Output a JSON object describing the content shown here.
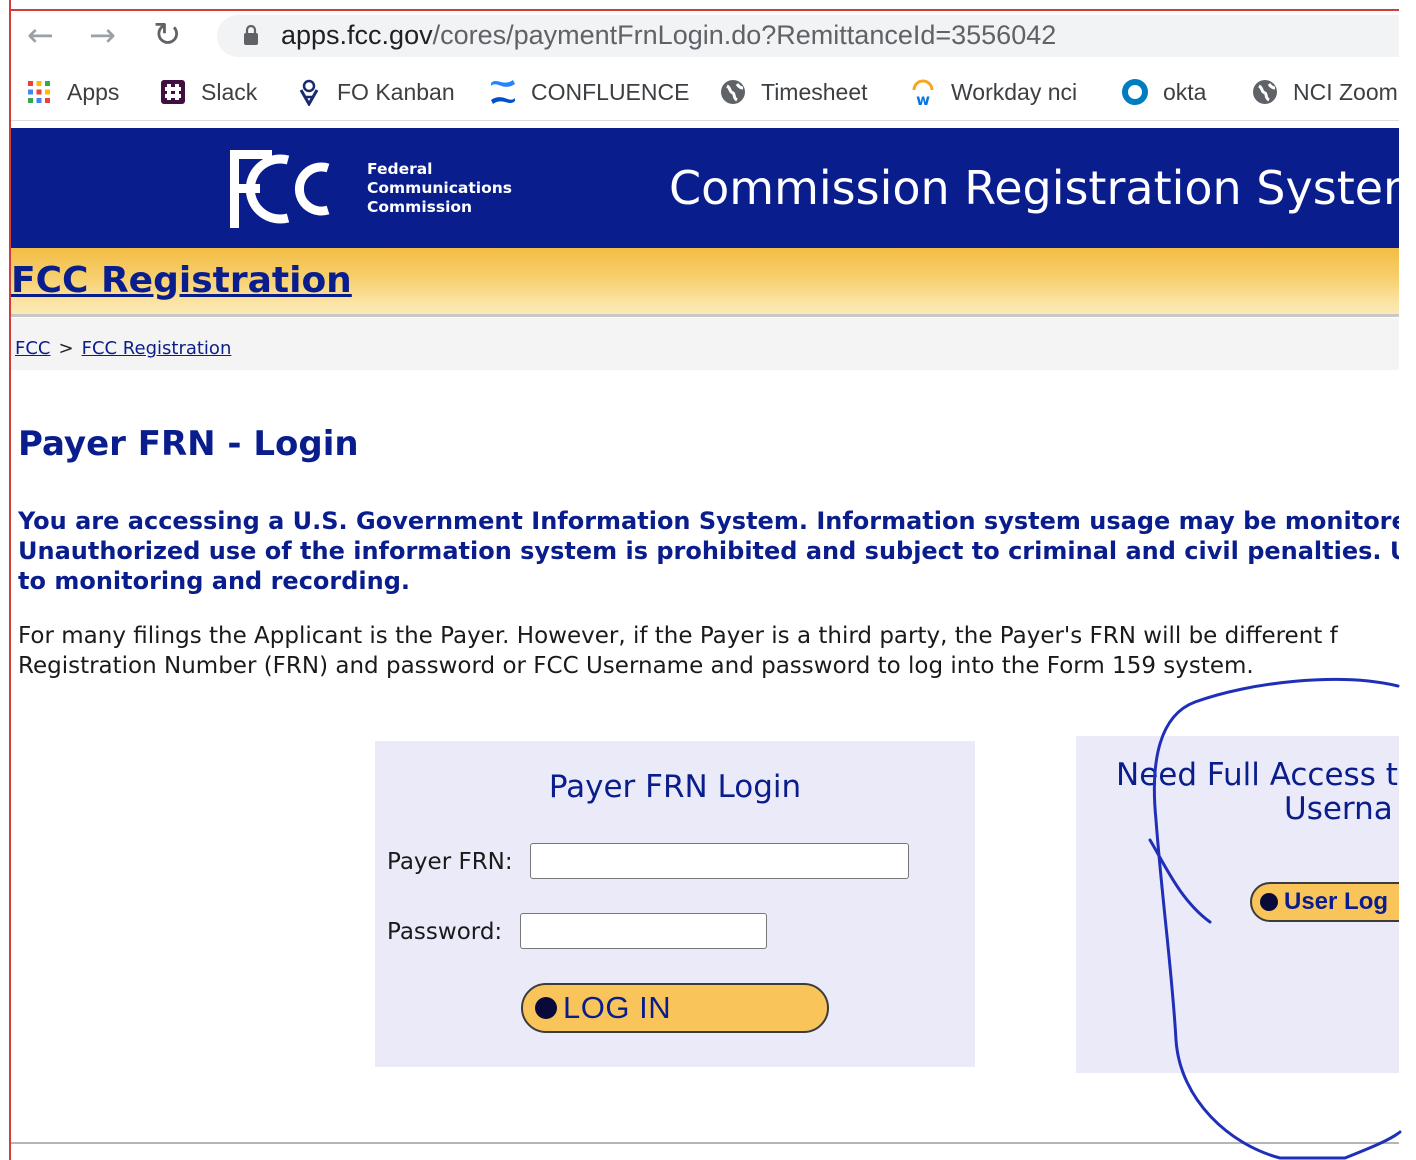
{
  "browser": {
    "url_host": "apps.fcc.gov",
    "url_path": "/cores/paymentFrnLogin.do?RemittanceId=3556042"
  },
  "bookmarks": [
    {
      "label": "Apps",
      "icon": "apps-grid-icon"
    },
    {
      "label": "Slack",
      "icon": "slack-icon"
    },
    {
      "label": "FO Kanban",
      "icon": "kanban-icon"
    },
    {
      "label": "CONFLUENCE",
      "icon": "confluence-icon"
    },
    {
      "label": "Timesheet",
      "icon": "globe-icon"
    },
    {
      "label": "Workday nci",
      "icon": "workday-icon"
    },
    {
      "label": "okta",
      "icon": "okta-icon"
    },
    {
      "label": "NCI Zoom",
      "icon": "globe-icon"
    }
  ],
  "header": {
    "agency_lines": [
      "Federal",
      "Communications",
      "Commission"
    ],
    "system_title": "Commission Registration System"
  },
  "section_title": "FCC Registration",
  "breadcrumb": {
    "root": "FCC",
    "separator": ">",
    "current": "FCC Registration"
  },
  "page_title": "Payer FRN - Login",
  "warning_lines": [
    "You are accessing a U.S. Government Information System. Information system usage may be monitored",
    "Unauthorized use of the information system is prohibited and subject to criminal and civil penalties. U",
    "to monitoring and recording."
  ],
  "info_lines": [
    "For many filings the Applicant is the Payer. However, if the Payer is a third party, the Payer's FRN will be different f",
    "Registration Number (FRN) and password or FCC Username and password to log into the Form 159 system."
  ],
  "login": {
    "heading": "Payer FRN Login",
    "frn_label": "Payer FRN:",
    "password_label": "Password:",
    "frn_value": "",
    "password_value": "",
    "button_label": "LOG IN"
  },
  "access": {
    "heading_line1": "Need Full Access t",
    "heading_line2": "Userna",
    "button_label": "User Log"
  },
  "colors": {
    "fcc_blue": "#0a1d8c",
    "button_gold": "#f9c55b",
    "panel_lavender": "#ebeaf9",
    "annotation_blue": "#1f2fb8"
  }
}
